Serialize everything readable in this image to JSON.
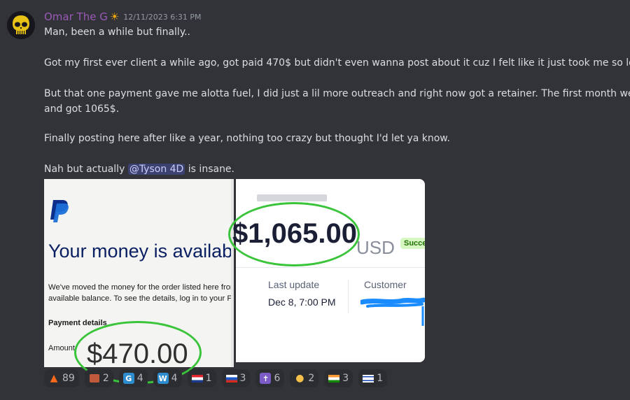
{
  "message": {
    "username": "Omar The G",
    "username_emoji": "☀",
    "timestamp": "12/11/2023 6:31 PM",
    "lines": [
      "Man, been a while but finally..",
      "Got my first ever client a while ago, got paid 470$ but didn't even wanna post about it cuz I felt like it just took me so long..",
      "But that one payment gave me alotta fuel, I did just a lil more outreach and right now got a retainer. The first month went by",
      "and got 1065$.",
      "Finally posting here after like a year, nothing too crazy but thought I'd let ya know."
    ],
    "last_line_prefix": "Nah but actually ",
    "mention": "@Tyson 4D",
    "last_line_suffix": " is insane."
  },
  "attachment_paypal": {
    "logo": "P",
    "title": "Your money is available",
    "body_line1": "We've moved the money for the order listed here from",
    "body_line2": "available balance. To see the details, log in to your P",
    "payment_details_label": "Payment details",
    "amount_label": "Amount",
    "amount_highlight": "$470.00"
  },
  "attachment_stripe": {
    "amount": "$1,065.00",
    "currency": "USD",
    "status": "Succeeded",
    "last_update_label": "Last update",
    "last_update_value": "Dec 8, 7:00 PM",
    "customer_label": "Customer"
  },
  "reactions": [
    {
      "icon": "fire-emoji",
      "glyph": "🔥",
      "count": "89"
    },
    {
      "icon": "image-emoji",
      "glyph": "🖼",
      "count": "2"
    },
    {
      "icon": "letter-g-emoji",
      "glyph": "G",
      "count": "4",
      "color": "#2d8ccd"
    },
    {
      "icon": "letter-w-emoji",
      "glyph": "W",
      "count": "4",
      "color": "#2d8ccd"
    },
    {
      "icon": "croatia-flag-emoji",
      "glyph": "▆",
      "count": "1"
    },
    {
      "icon": "russia-flag-emoji",
      "glyph": "▆",
      "count": "3"
    },
    {
      "icon": "latin-cross-emoji",
      "glyph": "✝",
      "count": "6"
    },
    {
      "icon": "clapping-hands-emoji",
      "glyph": "👏",
      "count": "2"
    },
    {
      "icon": "india-flag-emoji",
      "glyph": "▆",
      "count": "3"
    },
    {
      "icon": "israel-flag-emoji",
      "glyph": "✡",
      "count": "1"
    }
  ],
  "colors": {
    "background": "#313338",
    "username": "#9b59b6",
    "highlight_circle": "#3ac43a",
    "mention_bg": "#3c4270"
  }
}
